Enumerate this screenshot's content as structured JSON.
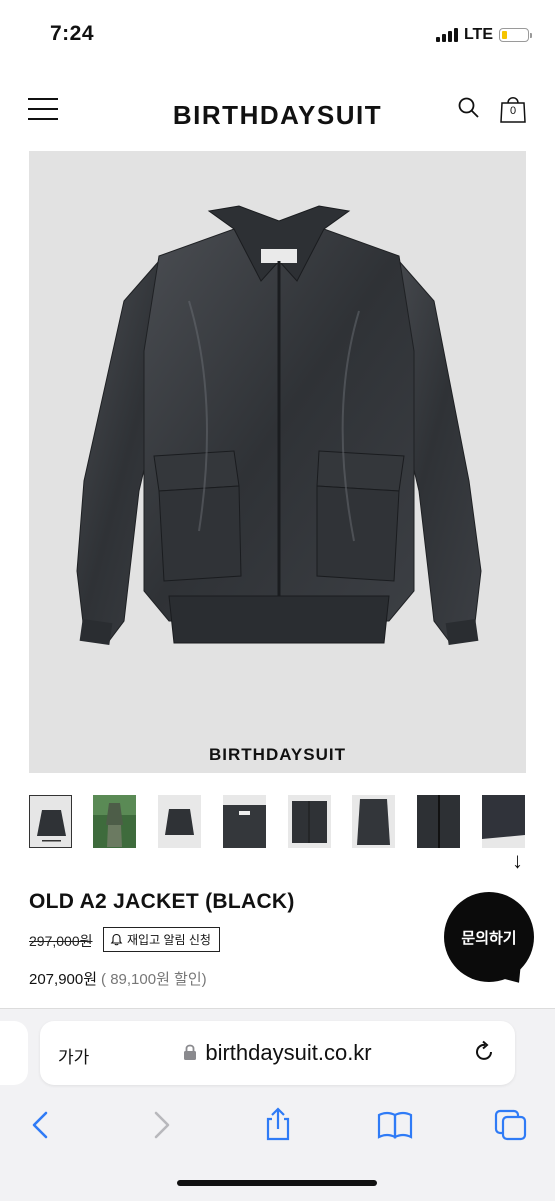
{
  "status_bar": {
    "time": "7:24",
    "network": "LTE"
  },
  "header": {
    "logo": "BIRTHDAYSUIT",
    "cart_count": "0"
  },
  "product": {
    "image_label": "BIRTHDAYSUIT",
    "name": "OLD A2 JACKET (BLACK)",
    "original_price": "297,000원",
    "sale_price": "207,900원",
    "discount": "( 89,100원 할인)"
  },
  "restock": {
    "label": "재입고 알림 신청"
  },
  "inquiry": {
    "label": "문의하기"
  },
  "browser": {
    "text_size": "가가",
    "url": "birthdaysuit.co.kr"
  }
}
